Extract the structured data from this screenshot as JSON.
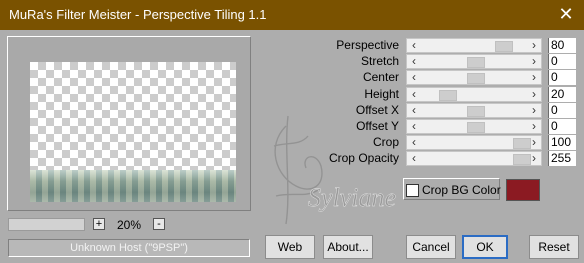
{
  "window": {
    "title": "MuRa's Filter Meister - Perspective Tiling 1.1",
    "close_glyph": "✕"
  },
  "preview": {
    "zoom_minus": "-",
    "zoom_plus": "+",
    "zoom_value": "20%"
  },
  "status": {
    "host": "Unknown Host (\"9PSP\")"
  },
  "controls": [
    {
      "label": "Perspective",
      "value": "80",
      "thumb": 0.8
    },
    {
      "label": "Stretch",
      "value": "0",
      "thumb": 0.5
    },
    {
      "label": "Center",
      "value": "0",
      "thumb": 0.5
    },
    {
      "label": "Height",
      "value": "20",
      "thumb": 0.2
    },
    {
      "label": "Offset X",
      "value": "0",
      "thumb": 0.5
    },
    {
      "label": "Offset Y",
      "value": "0",
      "thumb": 0.5
    },
    {
      "label": "Crop",
      "value": "100",
      "thumb": 1.0
    },
    {
      "label": "Crop Opacity",
      "value": "255",
      "thumb": 1.0
    }
  ],
  "crop_bg": {
    "label": "Crop BG Color",
    "checked": false,
    "color": "#8b1a22"
  },
  "buttons": {
    "web": "Web",
    "about": "About...",
    "cancel": "Cancel",
    "ok": "OK",
    "reset": "Reset"
  },
  "watermark": {
    "text": "Sylviane"
  },
  "colors": {
    "titlebar": "#7a5200",
    "dialog": "#adadad",
    "default_border": "#2b6cc4"
  }
}
